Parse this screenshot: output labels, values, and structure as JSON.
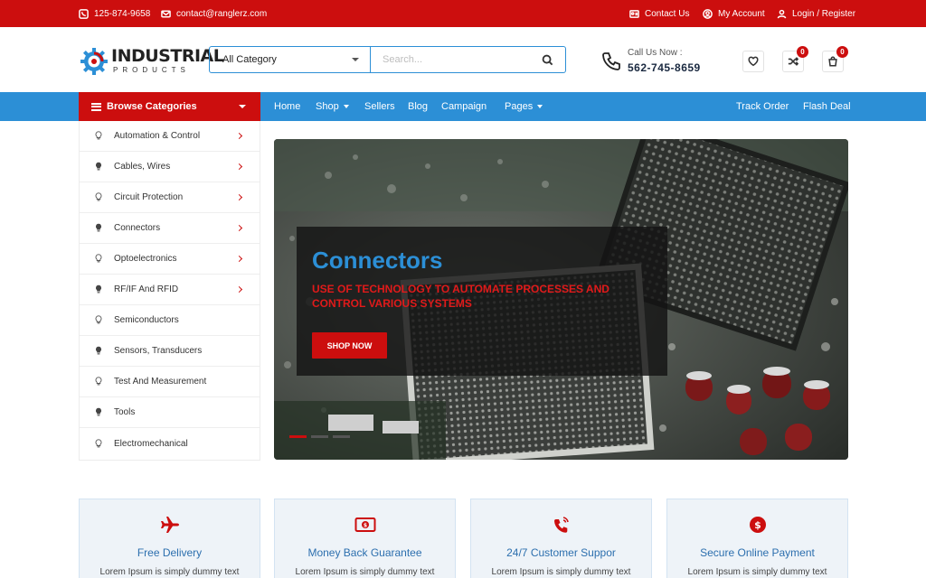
{
  "topbar": {
    "phone": "125-874-9658",
    "email": "contact@ranglerz.com",
    "contact_us": "Contact Us",
    "my_account": "My Account",
    "login_register": "Login / Register"
  },
  "header": {
    "logo_word": "INDUSTRIAL",
    "logo_sub": "PRODUCTS",
    "category_select": "All Category",
    "search_placeholder": "Search...",
    "call_label": "Call Us Now :",
    "call_number": "562-745-8659",
    "compare_count": "0",
    "cart_count": "0"
  },
  "nav": {
    "browse_label": "Browse Categories",
    "links": [
      "Home",
      "Shop",
      "Sellers",
      "Blog",
      "Campaign",
      "Pages"
    ],
    "right_links": [
      "Track Order",
      "Flash Deal"
    ]
  },
  "categories": [
    "Automation & Control",
    "Cables, Wires",
    "Circuit Protection",
    "Connectors",
    "Optoelectronics",
    "RF/IF And RFID",
    "Semiconductors",
    "Sensors, Transducers",
    "Test And Measurement",
    "Tools",
    "Electromechanical"
  ],
  "hero": {
    "title": "Connectors",
    "subtitle": "Use of technology to automate processes and control various systems",
    "cta": "SHOP NOW",
    "slides": 3,
    "active_slide": 1
  },
  "features": [
    {
      "icon": "plane-icon",
      "title": "Free Delivery",
      "desc": "Lorem Ipsum is simply dummy text"
    },
    {
      "icon": "money-icon",
      "title": "Money Back Guarantee",
      "desc": "Lorem Ipsum is simply dummy text"
    },
    {
      "icon": "phone-ring-icon",
      "title": "24/7 Customer Suppor",
      "desc": "Lorem Ipsum is simply dummy text"
    },
    {
      "icon": "secure-payment-icon",
      "title": "Secure Online Payment",
      "desc": "Lorem Ipsum is simply dummy text"
    }
  ],
  "colors": {
    "brand_red": "#cc0e0e",
    "brand_blue": "#2c8fd6"
  }
}
